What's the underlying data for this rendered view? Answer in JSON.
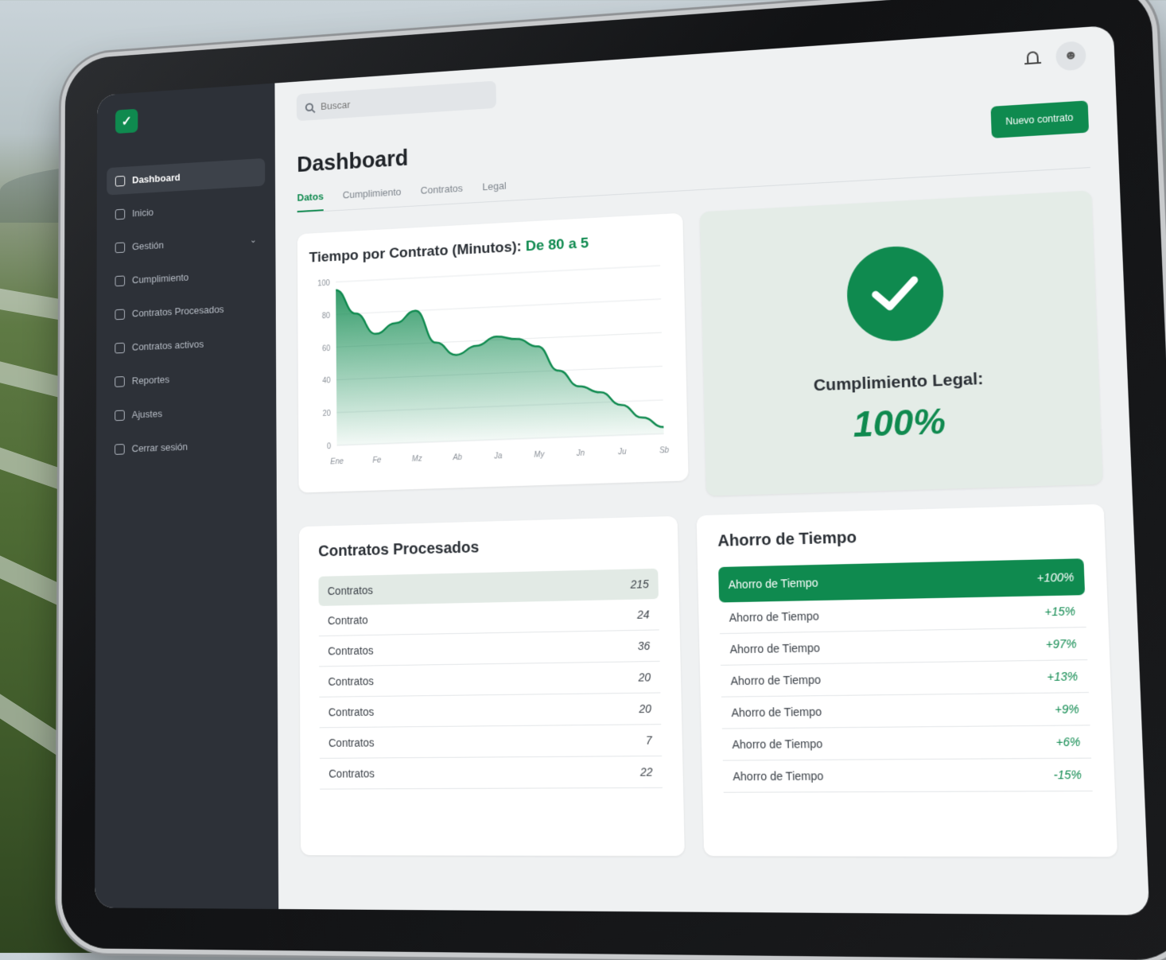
{
  "search": {
    "placeholder": "Buscar"
  },
  "sidebar": {
    "items": [
      {
        "label": "Dashboard",
        "active": true,
        "icon": "dashboard-icon"
      },
      {
        "label": "Inicio",
        "icon": "home-icon"
      },
      {
        "label": "Gestión",
        "icon": "folder-icon",
        "has_chevron": true
      },
      {
        "label": "Cumplimiento",
        "icon": "shield-icon"
      },
      {
        "label": "Contratos Procesados",
        "icon": "document-icon"
      },
      {
        "label": "Contratos activos",
        "icon": "contract-icon"
      },
      {
        "label": "Reportes",
        "icon": "report-icon"
      },
      {
        "label": "Ajustes",
        "icon": "gear-icon"
      },
      {
        "label": "Cerrar sesión",
        "icon": "logout-icon"
      }
    ]
  },
  "header": {
    "title": "Dashboard",
    "primary_action": "Nuevo contrato"
  },
  "tabs": [
    "Datos",
    "Cumplimiento",
    "Contratos",
    "Legal"
  ],
  "chart_card": {
    "title": "Tiempo por Contrato (Minutos):",
    "title_highlight": "De 80 a 5"
  },
  "chart_data": {
    "type": "area",
    "title": "Tiempo por Contrato (Minutos): De 80 a 5",
    "xlabel": "",
    "ylabel": "",
    "categories": [
      "Ene",
      "Fe",
      "Mz",
      "Ab",
      "Ja",
      "My",
      "Jn",
      "Ju",
      "Sb"
    ],
    "y_ticks": [
      0,
      20,
      40,
      60,
      80,
      100
    ],
    "ylim": [
      0,
      100
    ],
    "grid": true,
    "color": "#0f8a4f",
    "x": [
      0,
      0.5,
      1,
      1.5,
      2,
      2.5,
      3,
      3.5,
      4,
      4.5,
      5,
      5.5,
      6,
      6.5,
      7,
      7.5,
      8
    ],
    "values": [
      95,
      80,
      67,
      73,
      80,
      60,
      52,
      57,
      62,
      60,
      55,
      40,
      30,
      26,
      18,
      10,
      4
    ]
  },
  "compliance": {
    "label": "Cumplimiento Legal:",
    "value": "100%"
  },
  "contracts_card": {
    "title": "Contratos Procesados",
    "rows": [
      {
        "label": "Contratos",
        "value": "215"
      },
      {
        "label": "Contrato",
        "value": "24"
      },
      {
        "label": "Contratos",
        "value": "36"
      },
      {
        "label": "Contratos",
        "value": "20"
      },
      {
        "label": "Contratos",
        "value": "20"
      },
      {
        "label": "Contratos",
        "value": "7"
      },
      {
        "label": "Contratos",
        "value": "22"
      }
    ]
  },
  "savings_card": {
    "title": "Ahorro de Tiempo",
    "rows": [
      {
        "label": "Ahorro de Tiempo",
        "value": "+100%"
      },
      {
        "label": "Ahorro de Tiempo",
        "value": "+15%"
      },
      {
        "label": "Ahorro de Tiempo",
        "value": "+97%"
      },
      {
        "label": "Ahorro de Tiempo",
        "value": "+13%"
      },
      {
        "label": "Ahorro de Tiempo",
        "value": "+9%"
      },
      {
        "label": "Ahorro de Tiempo",
        "value": "+6%"
      },
      {
        "label": "Ahorro de Tiempo",
        "value": "-15%"
      }
    ]
  }
}
